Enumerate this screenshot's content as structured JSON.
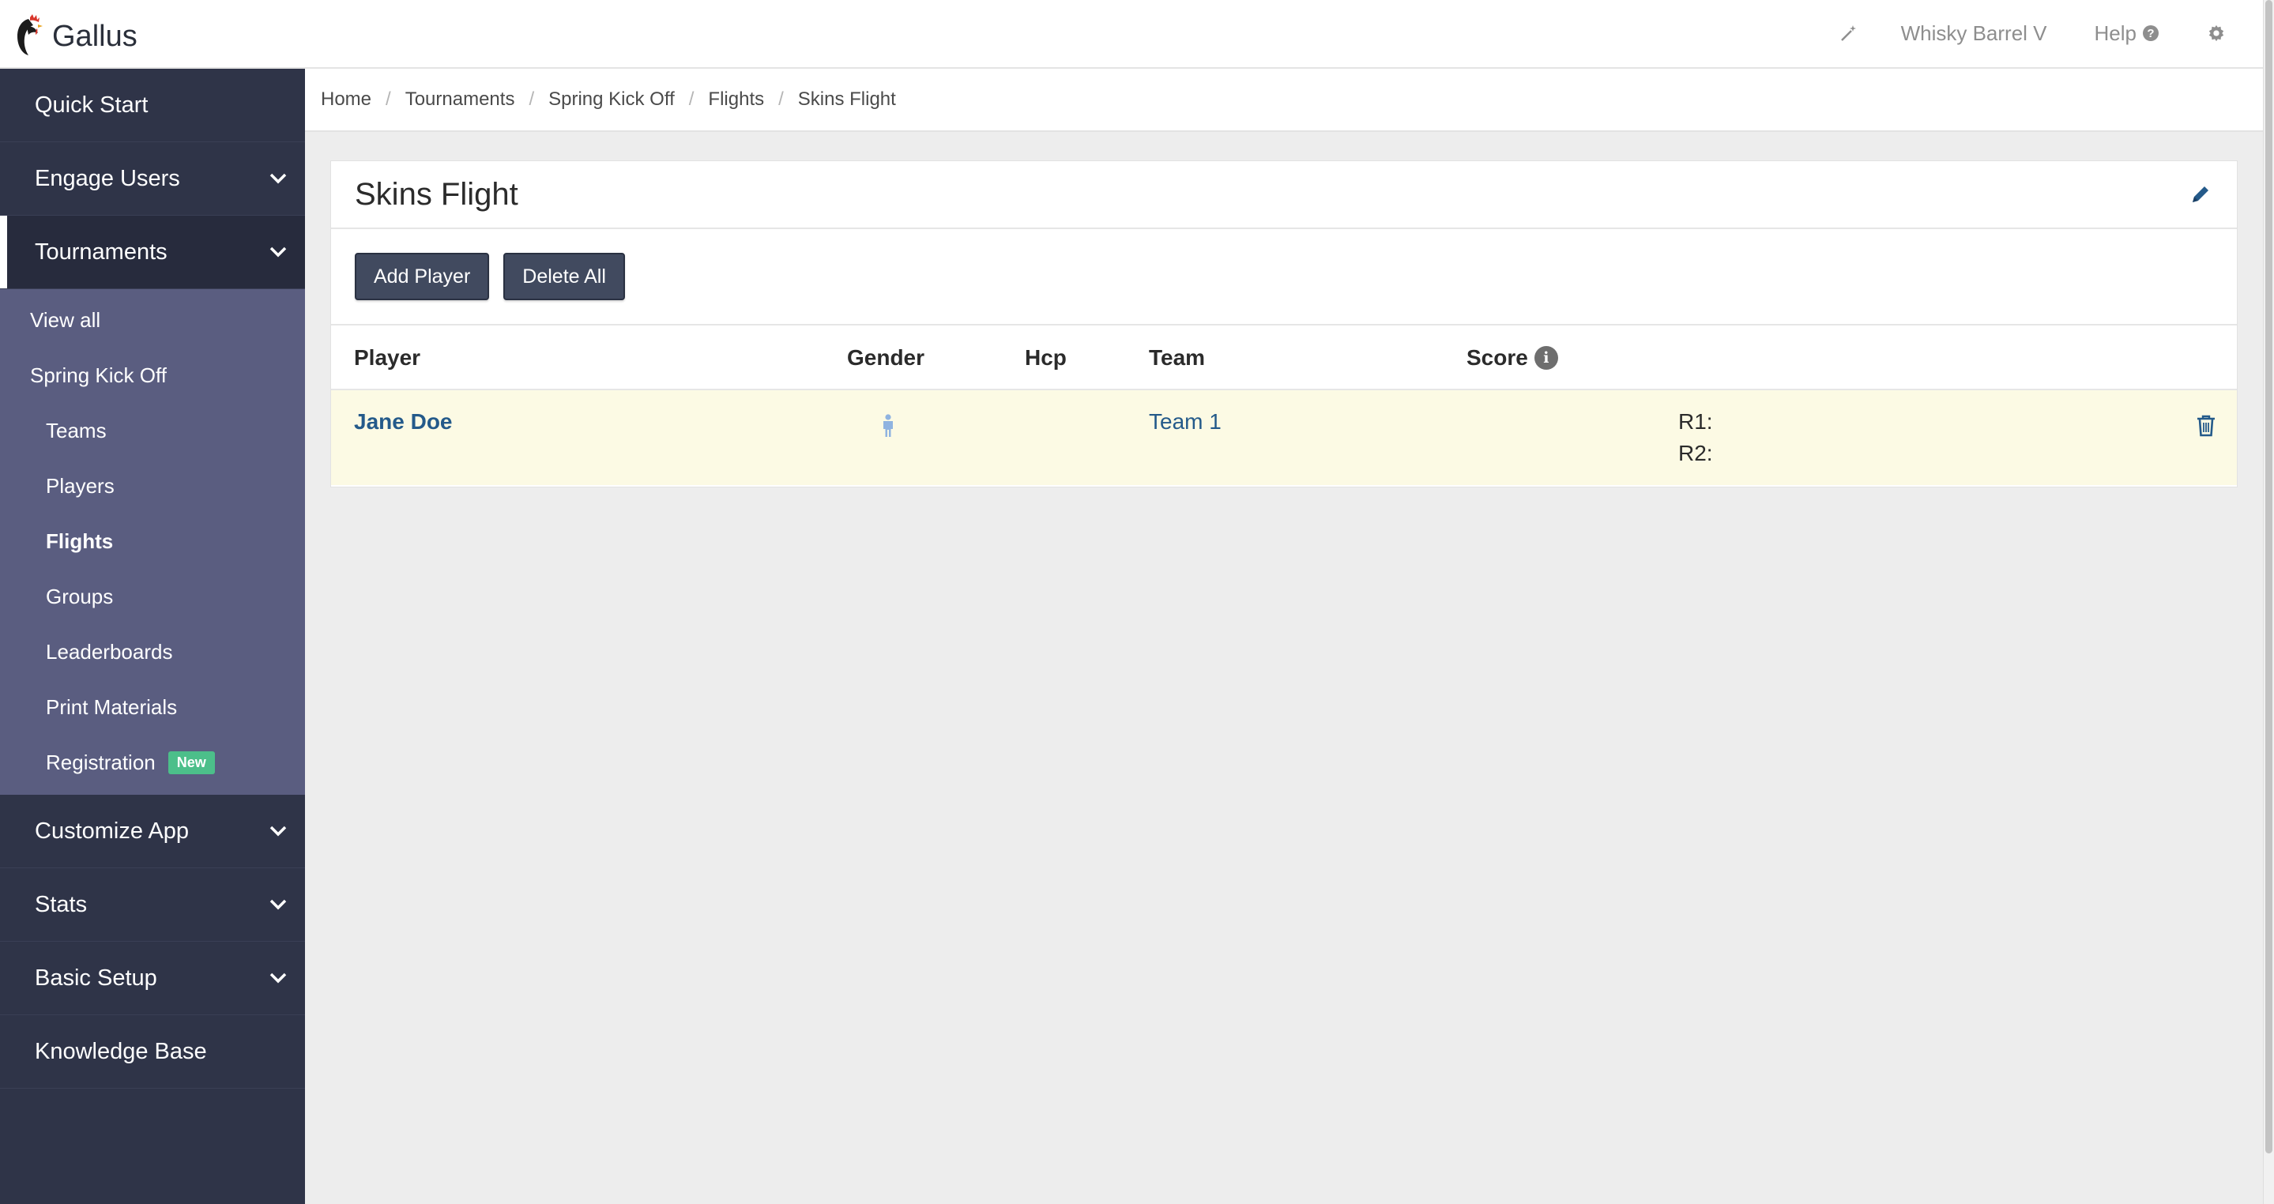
{
  "brand": {
    "name": "Gallus"
  },
  "topbar": {
    "org_name": "Whisky Barrel V",
    "help_label": "Help"
  },
  "sidebar": {
    "items": [
      {
        "label": "Quick Start"
      },
      {
        "label": "Engage Users"
      },
      {
        "label": "Tournaments"
      }
    ],
    "tournaments_sub": {
      "view_all": "View all",
      "tournament": "Spring Kick Off",
      "children": [
        "Teams",
        "Players",
        "Flights",
        "Groups",
        "Leaderboards",
        "Print Materials",
        "Registration"
      ],
      "new_badge": "New"
    },
    "bottom_items": [
      {
        "label": "Customize App"
      },
      {
        "label": "Stats"
      },
      {
        "label": "Basic Setup"
      },
      {
        "label": "Knowledge Base"
      }
    ]
  },
  "breadcrumb": [
    "Home",
    "Tournaments",
    "Spring Kick Off",
    "Flights",
    "Skins Flight"
  ],
  "panel": {
    "title": "Skins Flight",
    "add_player": "Add Player",
    "delete_all": "Delete All"
  },
  "table": {
    "headers": {
      "player": "Player",
      "gender": "Gender",
      "hcp": "Hcp",
      "team": "Team",
      "score": "Score"
    },
    "rows": [
      {
        "player": "Jane Doe",
        "team": "Team 1",
        "r1": "R1:",
        "r2": "R2:"
      }
    ]
  },
  "colors": {
    "sidebar": "#2f3448",
    "subnav": "#5a5d80",
    "link": "#245a8a",
    "row_highlight": "#fcfae4",
    "badge": "#4cbf8a"
  }
}
